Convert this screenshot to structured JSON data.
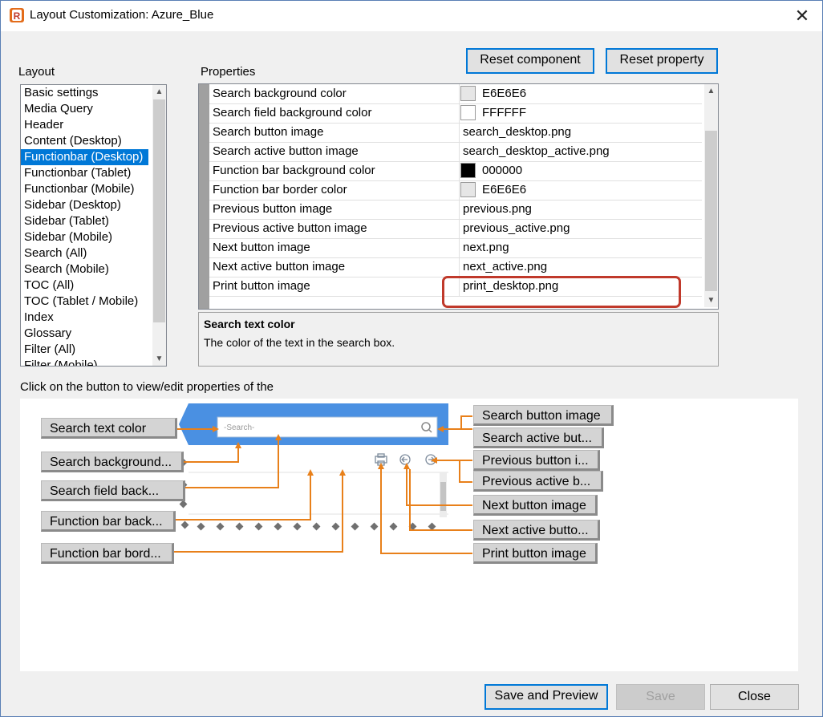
{
  "window": {
    "title": "Layout Customization: Azure_Blue"
  },
  "layout": {
    "label": "Layout",
    "items": [
      {
        "label": "Basic settings",
        "selected": false
      },
      {
        "label": "Media Query",
        "selected": false
      },
      {
        "label": "Header",
        "selected": false
      },
      {
        "label": "Content (Desktop)",
        "selected": false
      },
      {
        "label": "Functionbar (Desktop)",
        "selected": true
      },
      {
        "label": "Functionbar (Tablet)",
        "selected": false
      },
      {
        "label": "Functionbar (Mobile)",
        "selected": false
      },
      {
        "label": "Sidebar (Desktop)",
        "selected": false
      },
      {
        "label": "Sidebar (Tablet)",
        "selected": false
      },
      {
        "label": "Sidebar (Mobile)",
        "selected": false
      },
      {
        "label": "Search (All)",
        "selected": false
      },
      {
        "label": "Search (Mobile)",
        "selected": false
      },
      {
        "label": "TOC (All)",
        "selected": false
      },
      {
        "label": "TOC (Tablet / Mobile)",
        "selected": false
      },
      {
        "label": "Index",
        "selected": false
      },
      {
        "label": "Glossary",
        "selected": false
      },
      {
        "label": "Filter (All)",
        "selected": false
      },
      {
        "label": "Filter (Mobile)",
        "selected": false
      }
    ]
  },
  "properties": {
    "label": "Properties",
    "reset_component": "Reset component",
    "reset_property": "Reset property",
    "rows": [
      {
        "name": "Search background color",
        "value": "E6E6E6",
        "swatch": "#E6E6E6"
      },
      {
        "name": "Search field background color",
        "value": "FFFFFF",
        "swatch": "#FFFFFF"
      },
      {
        "name": "Search button image",
        "value": "search_desktop.png",
        "swatch": null
      },
      {
        "name": "Search active button image",
        "value": "search_desktop_active.png",
        "swatch": null
      },
      {
        "name": "Function bar background color",
        "value": "000000",
        "swatch": "#000000"
      },
      {
        "name": "Function bar border color",
        "value": "E6E6E6",
        "swatch": "#E6E6E6"
      },
      {
        "name": "Previous button image",
        "value": "previous.png",
        "swatch": null
      },
      {
        "name": "Previous active button image",
        "value": "previous_active.png",
        "swatch": null
      },
      {
        "name": "Next button image",
        "value": "next.png",
        "swatch": null
      },
      {
        "name": "Next active button image",
        "value": "next_active.png",
        "swatch": null
      },
      {
        "name": "Print button image",
        "value": "print_desktop.png",
        "swatch": null
      }
    ],
    "description": {
      "title": "Search text color",
      "text": "The color of the text in the search box."
    }
  },
  "preview": {
    "instruction": "Click on the button to view/edit properties of the",
    "search_placeholder": "-Search-",
    "left_buttons": [
      "Search text color",
      "Search background...",
      "Search field back...",
      "Function bar back...",
      "Function bar bord..."
    ],
    "right_buttons": [
      "Search button image",
      "Search active but...",
      "Previous button i...",
      "Previous active b...",
      "Next button image",
      "Next active butto...",
      "Print button image"
    ],
    "colors": {
      "header_blue": "#4a90e2",
      "arrow_orange": "#e8801a"
    }
  },
  "footer": {
    "save_preview": "Save and Preview",
    "save": "Save",
    "close": "Close"
  }
}
